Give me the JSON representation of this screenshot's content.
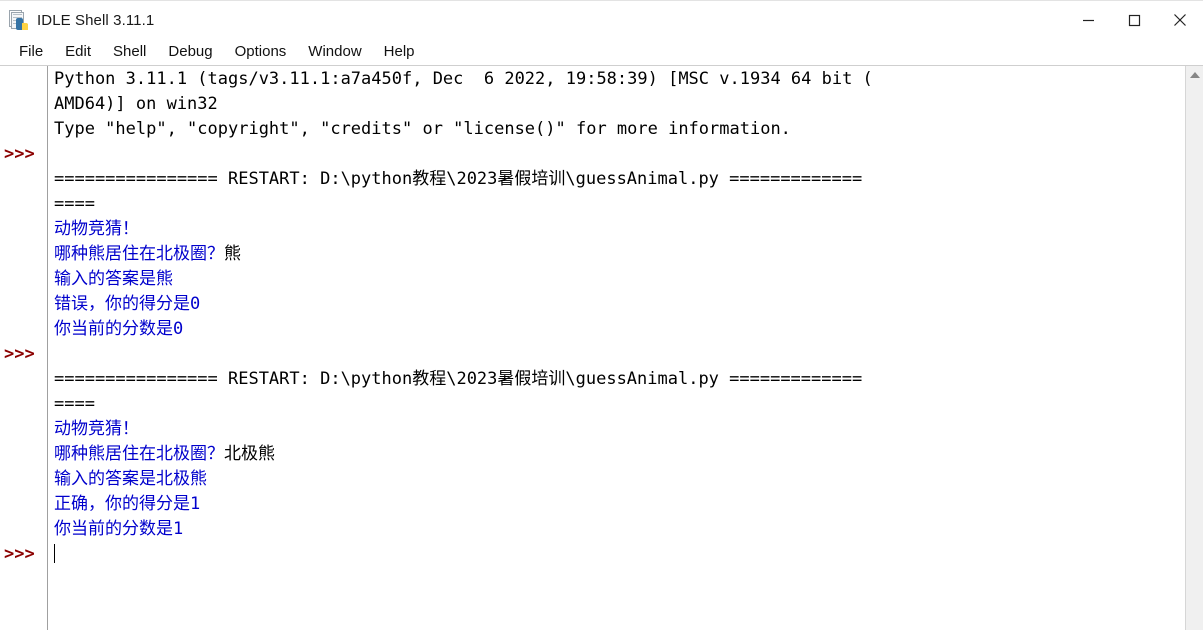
{
  "window": {
    "title": "IDLE Shell 3.11.1",
    "icon": "idle-python-icon",
    "controls": {
      "minimize": "minimize",
      "maximize": "maximize",
      "close": "close"
    }
  },
  "menubar": {
    "items": [
      {
        "label": "File"
      },
      {
        "label": "Edit"
      },
      {
        "label": "Shell"
      },
      {
        "label": "Debug"
      },
      {
        "label": "Options"
      },
      {
        "label": "Window"
      },
      {
        "label": "Help"
      }
    ]
  },
  "shell": {
    "prompt_symbol": ">>>",
    "colors": {
      "output_blue": "#0000cc",
      "input_black": "#000000",
      "prompt_dark_red": "#8b0000",
      "background": "#ffffff"
    },
    "lines": [
      {
        "id": "banner-1",
        "text": "Python 3.11.1 (tags/v3.11.1:a7a450f, Dec  6 2022, 19:58:39) [MSC v.1934 64 bit (",
        "kind": "banner",
        "prompt": false
      },
      {
        "id": "banner-2",
        "text": "AMD64)] on win32",
        "kind": "banner",
        "prompt": false
      },
      {
        "id": "banner-3",
        "text": "Type \"help\", \"copyright\", \"credits\" or \"license()\" for more information.",
        "kind": "banner",
        "prompt": false
      },
      {
        "id": "blank-1",
        "text": "",
        "kind": "blank",
        "prompt": true
      },
      {
        "id": "restart-1a",
        "text": "================ RESTART: D:\\python教程\\2023暑假培训\\guessAnimal.py =============",
        "kind": "restart",
        "prompt": false
      },
      {
        "id": "restart-1b",
        "text": "====",
        "kind": "restart",
        "prompt": false
      },
      {
        "id": "out-1-1",
        "out": "动物竞猜！",
        "in": "",
        "kind": "output",
        "prompt": false
      },
      {
        "id": "out-1-2",
        "out": "哪种熊居住在北极圈？",
        "in": "熊",
        "kind": "output-input",
        "prompt": false
      },
      {
        "id": "out-1-3",
        "out": "输入的答案是熊",
        "in": "",
        "kind": "output",
        "prompt": false
      },
      {
        "id": "out-1-4",
        "out": "错误，你的得分是0",
        "in": "",
        "kind": "output",
        "prompt": false
      },
      {
        "id": "out-1-5",
        "out": "你当前的分数是0",
        "in": "",
        "kind": "output",
        "prompt": false
      },
      {
        "id": "blank-2",
        "text": "",
        "kind": "blank",
        "prompt": true
      },
      {
        "id": "restart-2a",
        "text": "================ RESTART: D:\\python教程\\2023暑假培训\\guessAnimal.py =============",
        "kind": "restart",
        "prompt": false
      },
      {
        "id": "restart-2b",
        "text": "====",
        "kind": "restart",
        "prompt": false
      },
      {
        "id": "out-2-1",
        "out": "动物竞猜！",
        "in": "",
        "kind": "output",
        "prompt": false
      },
      {
        "id": "out-2-2",
        "out": "哪种熊居住在北极圈？",
        "in": "北极熊",
        "kind": "output-input",
        "prompt": false
      },
      {
        "id": "out-2-3",
        "out": "输入的答案是北极熊",
        "in": "",
        "kind": "output",
        "prompt": false
      },
      {
        "id": "out-2-4",
        "out": "正确，你的得分是1",
        "in": "",
        "kind": "output",
        "prompt": false
      },
      {
        "id": "out-2-5",
        "out": "你当前的分数是1",
        "in": "",
        "kind": "output",
        "prompt": false
      },
      {
        "id": "cursor-line",
        "text": "",
        "kind": "cursor",
        "prompt": true
      }
    ],
    "script_path": "D:\\python教程\\2023暑假培训\\guessAnimal.py",
    "restart_label": "RESTART:"
  },
  "scrollbar": {
    "up_arrow": "scroll-up-arrow",
    "orientation": "vertical"
  }
}
